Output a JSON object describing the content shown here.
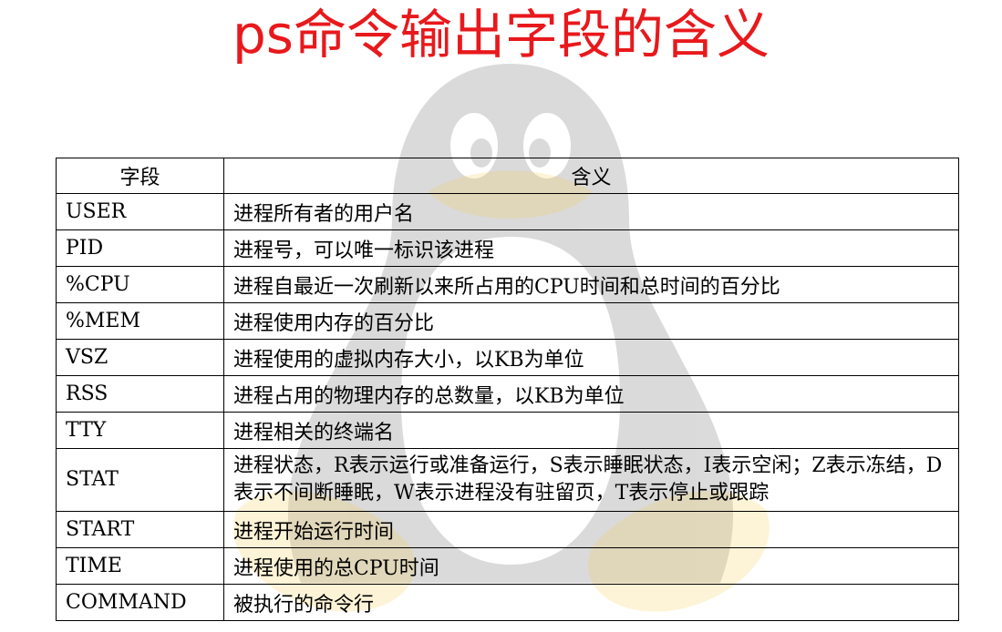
{
  "title": "ps命令输出字段的含义",
  "table": {
    "headers": [
      "字段",
      "含义"
    ],
    "rows": [
      {
        "field": "USER",
        "meaning": "进程所有者的用户名"
      },
      {
        "field": "PID",
        "meaning": "进程号，可以唯一标识该进程"
      },
      {
        "field": "%CPU",
        "meaning": "进程自最近一次刷新以来所占用的CPU时间和总时间的百分比"
      },
      {
        "field": "%MEM",
        "meaning": "进程使用内存的百分比"
      },
      {
        "field": "VSZ",
        "meaning": "进程使用的虚拟内存大小，以KB为单位"
      },
      {
        "field": "RSS",
        "meaning": "进程占用的物理内存的总数量，以KB为单位"
      },
      {
        "field": "TTY",
        "meaning": "进程相关的终端名"
      },
      {
        "field": "STAT",
        "meaning": "进程状态，R表示运行或准备运行，S表示睡眠状态，I表示空闲；Z表示冻结，D表示不间断睡眠，W表示进程没有驻留页，T表示停止或跟踪"
      },
      {
        "field": "START",
        "meaning": "进程开始运行时间"
      },
      {
        "field": "TIME",
        "meaning": "进程使用的总CPU时间"
      },
      {
        "field": "COMMAND",
        "meaning": "被执行的命令行"
      }
    ]
  },
  "watermark": {
    "icon": "tux-penguin-icon",
    "color": "#cfcfcf",
    "beak": "#f6c94a"
  }
}
